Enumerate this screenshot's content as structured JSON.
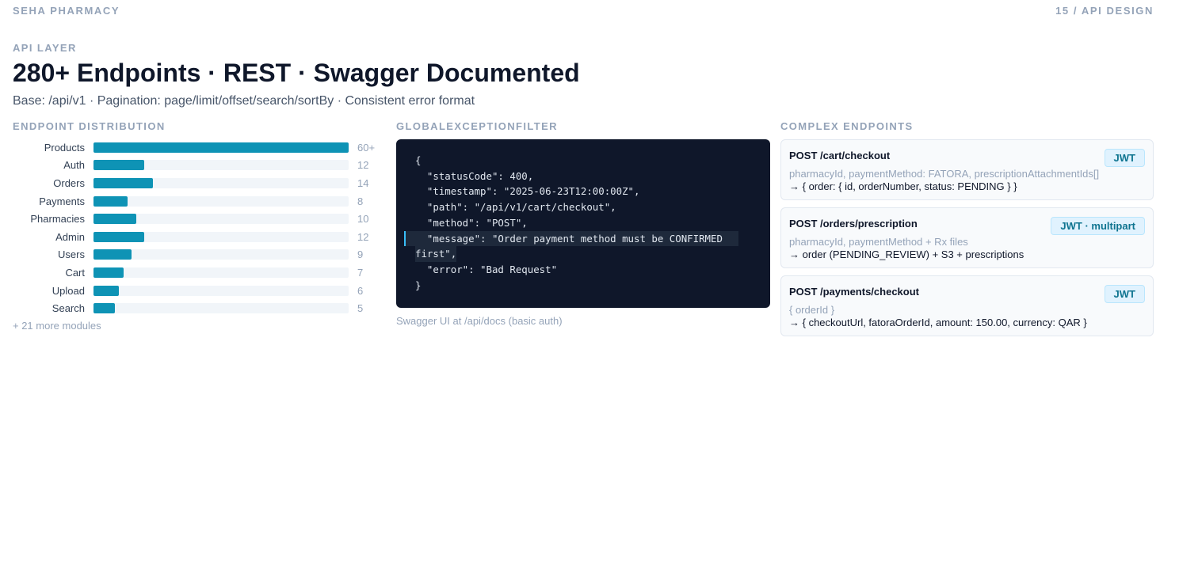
{
  "header": {
    "brand": "SEHA PHARMACY",
    "page_indicator": "15 / API DESIGN"
  },
  "eyebrow": "API LAYER",
  "title": "280+ Endpoints · REST · Swagger Documented",
  "subtitle": "Base: /api/v1 · Pagination: page/limit/offset/search/sortBy · Consistent error format",
  "distribution": {
    "label": "ENDPOINT DISTRIBUTION",
    "more": "+ 21 more modules"
  },
  "chart_data": {
    "type": "bar",
    "orientation": "horizontal",
    "title": "ENDPOINT DISTRIBUTION",
    "categories": [
      "Products",
      "Auth",
      "Orders",
      "Payments",
      "Pharmacies",
      "Admin",
      "Users",
      "Cart",
      "Upload",
      "Search"
    ],
    "values": [
      60,
      12,
      14,
      8,
      10,
      12,
      9,
      7,
      6,
      5
    ],
    "value_labels": [
      "60+",
      "12",
      "14",
      "8",
      "10",
      "12",
      "9",
      "7",
      "6",
      "5"
    ],
    "xlim": [
      0,
      60
    ],
    "bar_color": "#0e93b5"
  },
  "exception_filter": {
    "label": "GLOBALEXCEPTIONFILTER",
    "code_lines": [
      "{",
      "  \"statusCode\": 400,",
      "  \"timestamp\": \"2025-06-23T12:00:00Z\",",
      "  \"path\": \"/api/v1/cart/checkout\",",
      "  \"method\": \"POST\",",
      "  \"message\": \"Order payment method must be CONFIRMED",
      "first\",",
      "  \"error\": \"Bad Request\"",
      "}"
    ],
    "caption": "Swagger UI at /api/docs (basic auth)"
  },
  "complex": {
    "label": "COMPLEX ENDPOINTS",
    "cards": [
      {
        "endpoint": "POST /cart/checkout",
        "badge": "JWT",
        "request": "pharmacyId, paymentMethod: FATORA, prescriptionAttachmentIds[]",
        "response": "→ { order: { id, orderNumber, status: PENDING } }"
      },
      {
        "endpoint": "POST /orders/prescription",
        "badge": "JWT · multipart",
        "request": "pharmacyId, paymentMethod + Rx files",
        "response": "→ order (PENDING_REVIEW) + S3 + prescriptions"
      },
      {
        "endpoint": "POST /payments/checkout",
        "badge": "JWT",
        "request": "{ orderId }",
        "response": "→ { checkoutUrl, fatoraOrderId, amount: 150.00, currency: QAR }"
      }
    ]
  },
  "colors": {
    "accent": "#0e93b5",
    "code_bg": "#0f172a",
    "muted": "#94a3b8"
  }
}
